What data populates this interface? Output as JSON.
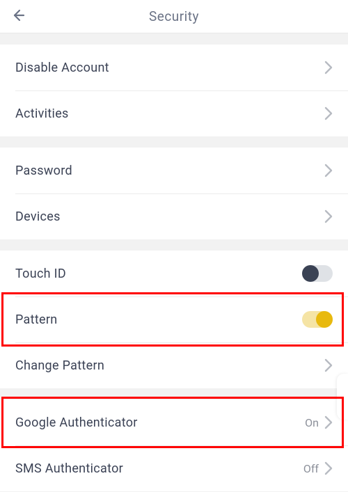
{
  "header": {
    "title": "Security"
  },
  "groups": [
    {
      "rows": [
        {
          "key": "disable-account",
          "label": "Disable Account",
          "type": "chevron"
        },
        {
          "key": "activities",
          "label": "Activities",
          "type": "chevron"
        }
      ]
    },
    {
      "rows": [
        {
          "key": "password",
          "label": "Password",
          "type": "chevron"
        },
        {
          "key": "devices",
          "label": "Devices",
          "type": "chevron"
        }
      ]
    },
    {
      "rows": [
        {
          "key": "touch-id",
          "label": "Touch ID",
          "type": "toggle",
          "on": false
        },
        {
          "key": "pattern",
          "label": "Pattern",
          "type": "toggle",
          "on": true
        },
        {
          "key": "change-pattern",
          "label": "Change Pattern",
          "type": "chevron"
        }
      ]
    },
    {
      "rows": [
        {
          "key": "google-authenticator",
          "label": "Google Authenticator",
          "type": "value-chevron",
          "value": "On"
        },
        {
          "key": "sms-authenticator",
          "label": "SMS Authenticator",
          "type": "value-chevron",
          "value": "Off"
        }
      ]
    }
  ],
  "colors": {
    "accent_on": "#e8b90e",
    "accent_on_track": "#f5e4a5",
    "off_knob": "#3a4254",
    "off_track": "#dfe2e6",
    "chevron": "#b7bbc2",
    "highlight": "#ff0000"
  }
}
